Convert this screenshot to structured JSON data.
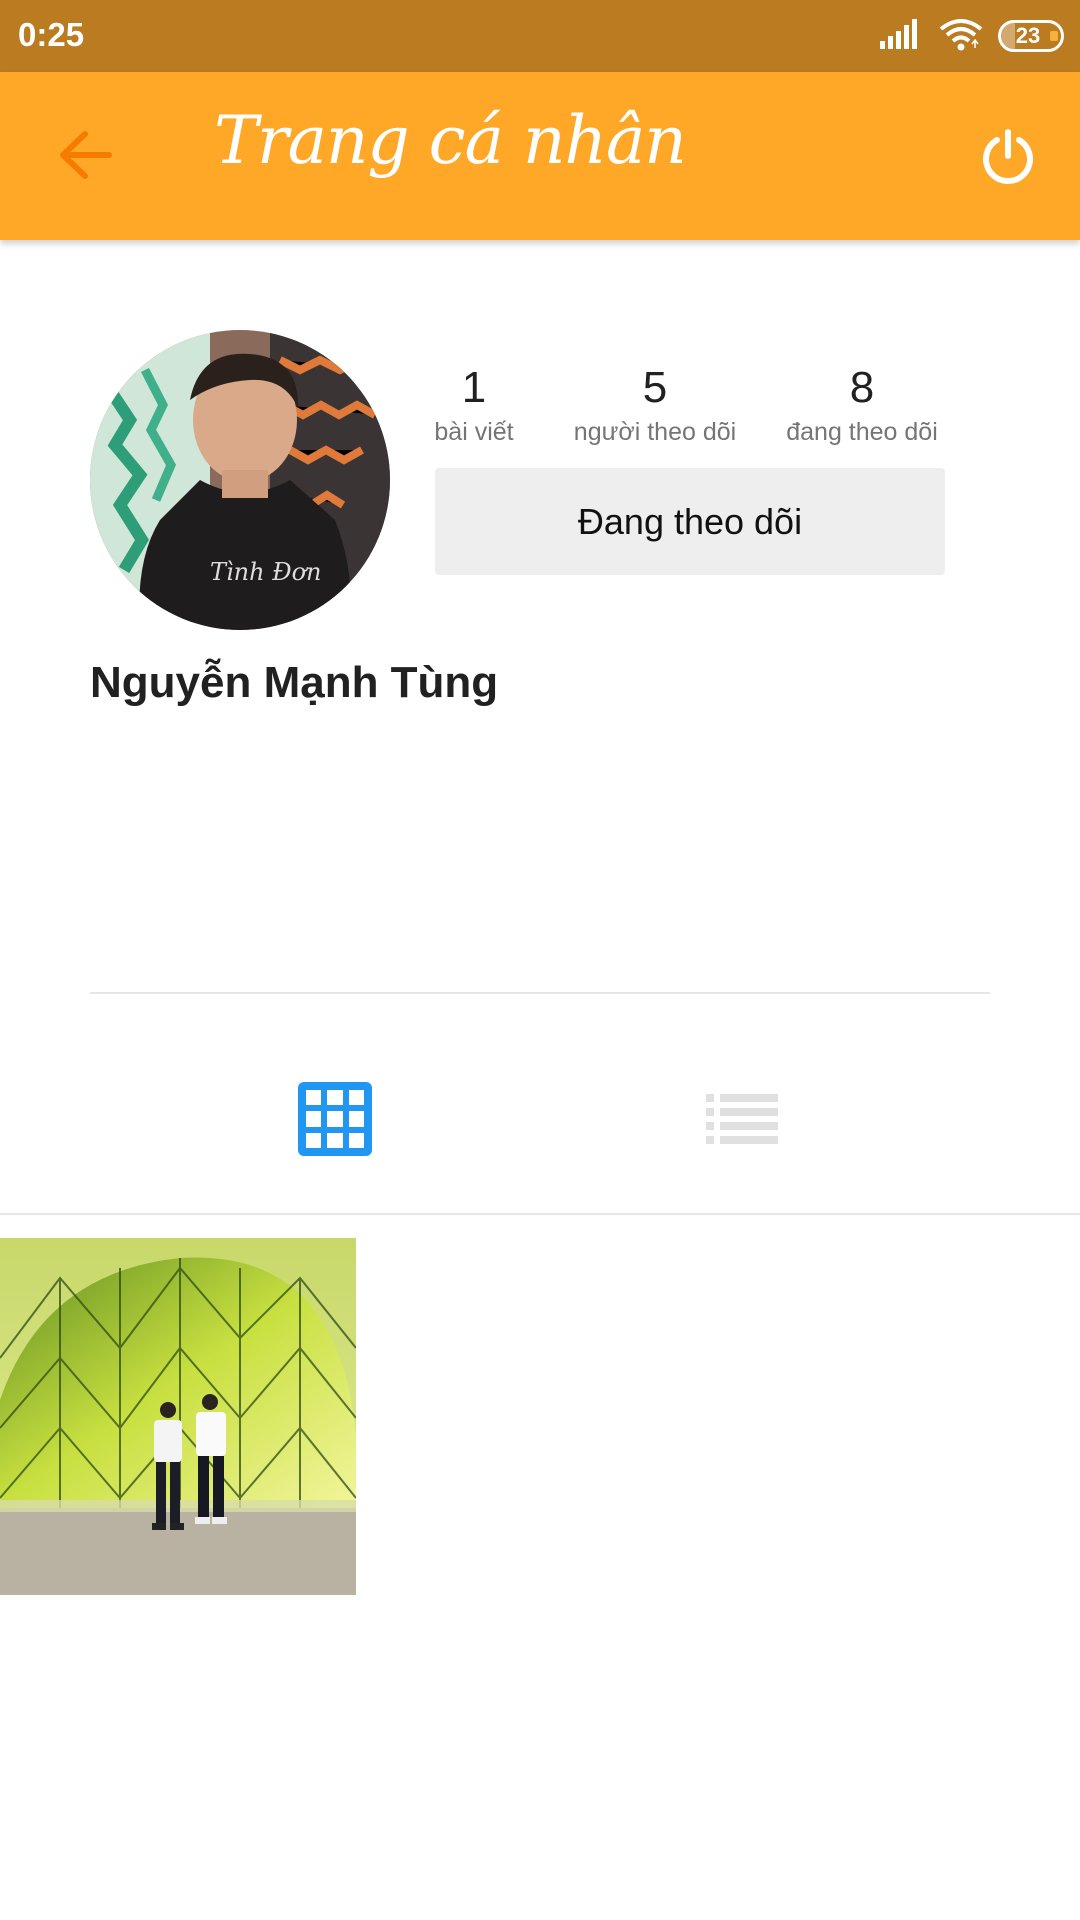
{
  "status_bar": {
    "time": "0:25",
    "battery": "23",
    "battery_fraction": 0.23
  },
  "app_bar": {
    "title": "Trang cá nhân",
    "back_icon": "arrow-back-icon",
    "power_icon": "power-icon"
  },
  "profile": {
    "name": "Nguyễn Mạnh Tùng",
    "stats": [
      {
        "value": "1",
        "label": "bài viết"
      },
      {
        "value": "5",
        "label": "người theo dõi"
      },
      {
        "value": "8",
        "label": "đang theo dõi"
      }
    ],
    "follow_button_label": "Đang theo dõi"
  },
  "tabs": {
    "grid_icon": "grid-view-icon",
    "list_icon": "list-view-icon",
    "active": "grid"
  },
  "colors": {
    "status_bar": "#BA7B21",
    "app_bar": "#FFA726",
    "accent_blue": "#2196F3",
    "inactive_icon": "#E0E0E0"
  }
}
